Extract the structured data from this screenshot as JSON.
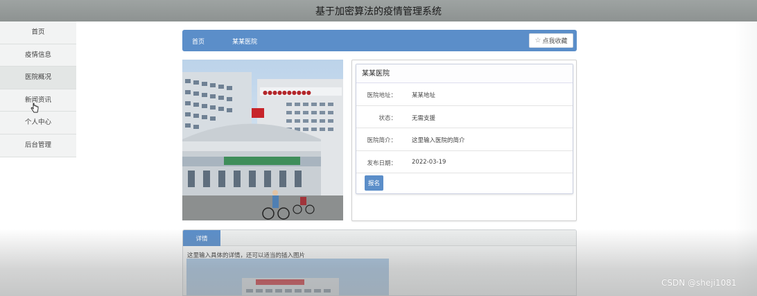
{
  "header": {
    "title": "基于加密算法的疫情管理系统"
  },
  "sidebar": {
    "items": [
      {
        "label": "首页"
      },
      {
        "label": "疫情信息"
      },
      {
        "label": "医院概况"
      },
      {
        "label": "新闻资讯"
      },
      {
        "label": "个人中心"
      },
      {
        "label": "后台管理"
      }
    ]
  },
  "breadcrumb": {
    "home": "首页",
    "current": "某某医院",
    "favorite_label": "点我收藏"
  },
  "info": {
    "name": "某某医院",
    "rows": [
      {
        "label": "医院地址：",
        "value": "某某地址"
      },
      {
        "label": "状态：",
        "value": "无需支援"
      },
      {
        "label": "医院简介：",
        "value": "这里输入医院的简介"
      },
      {
        "label": "发布日期：",
        "value": "2022-03-19"
      }
    ],
    "signup_label": "报名"
  },
  "details": {
    "tab": "详情",
    "text": "这里输入具体的详情，还可以适当的插入图片"
  },
  "watermark": "CSDN @sheji1081",
  "colors": {
    "accent": "#5b8ec9",
    "header": "#9ea3a2"
  }
}
